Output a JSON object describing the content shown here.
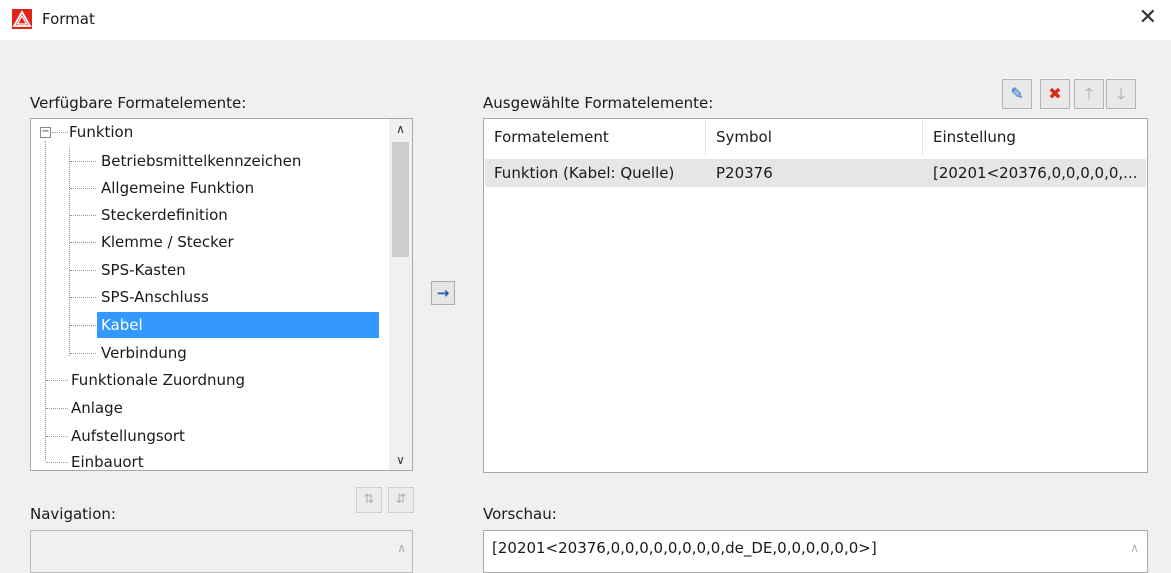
{
  "window": {
    "title": "Format",
    "close_symbol": "✕"
  },
  "available": {
    "label": "Verfügbare Formatelemente:",
    "tree": {
      "root": {
        "label": "Funktion",
        "expander": "−"
      },
      "children": [
        "Betriebsmittelkennzeichen",
        "Allgemeine Funktion",
        "Steckerdefinition",
        "Klemme / Stecker",
        "SPS-Kasten",
        "SPS-Anschluss",
        "Kabel",
        "Verbindung"
      ],
      "selected": "Kabel",
      "siblings": [
        "Funktionale Zuordnung",
        "Anlage",
        "Aufstellungsort",
        "Einbauort"
      ]
    }
  },
  "selected_elements": {
    "label": "Ausgewählte Formatelemente:",
    "columns": [
      "Formatelement",
      "Symbol",
      "Einstellung"
    ],
    "rows": [
      [
        "Funktion (Kabel: Quelle)",
        "P20376",
        "[20201<20376,0,0,0,0,0,..."
      ]
    ]
  },
  "toolbar": {
    "edit_icon": "✎",
    "delete_icon": "✖",
    "up_icon": "🡑",
    "down_icon": "🡓"
  },
  "move_right_icon": "→",
  "navigation": {
    "label": "Navigation:",
    "up_down_icon": "⇅",
    "down_up_icon": "⇵"
  },
  "preview": {
    "label": "Vorschau:",
    "value": "[20201<20376,0,0,0,0,0,0,0,0,de_DE,0,0,0,0,0,0>]"
  },
  "colors": {
    "selection": "#3399ff",
    "accent": "#1e64c8",
    "delete": "#d52b1e"
  }
}
